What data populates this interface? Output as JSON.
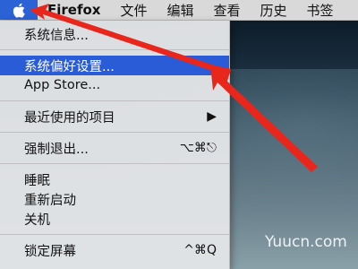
{
  "menubar": {
    "apple_icon": "apple-icon",
    "items": [
      "Firefox",
      "文件",
      "编辑",
      "查看",
      "历史",
      "书签"
    ]
  },
  "apple_menu": {
    "items": [
      {
        "label": "系统信息...",
        "shortcut": ""
      },
      {
        "label": "系统偏好设置...",
        "shortcut": "",
        "selected": true
      },
      {
        "label": "App Store...",
        "shortcut": ""
      },
      {
        "label": "最近使用的项目",
        "shortcut": "▶"
      },
      {
        "label": "强制退出...",
        "shortcut": "⌥⌘⎋"
      },
      {
        "label": "睡眠",
        "shortcut": ""
      },
      {
        "label": "重新启动",
        "shortcut": ""
      },
      {
        "label": "关机",
        "shortcut": ""
      },
      {
        "label": "锁定屏幕",
        "shortcut": "^⌘Q"
      }
    ]
  },
  "colors": {
    "selection": "#2b5cd8",
    "arrow": "#e8261c"
  },
  "watermark": "Yuucn.com"
}
